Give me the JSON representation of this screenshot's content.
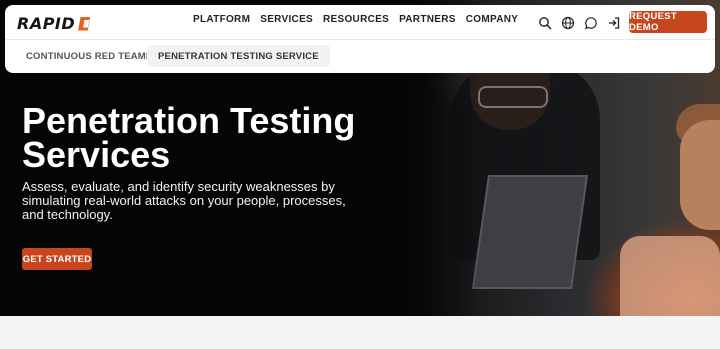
{
  "header": {
    "logo_text": "RAPID",
    "menu": [
      {
        "label": "PLATFORM"
      },
      {
        "label": "SERVICES"
      },
      {
        "label": "RESOURCES"
      },
      {
        "label": "PARTNERS"
      },
      {
        "label": "COMPANY"
      }
    ],
    "icons": [
      "search-icon",
      "globe-icon",
      "chat-icon",
      "sign-in-icon"
    ],
    "demo_label": "REQUEST DEMO"
  },
  "subnav": {
    "items": [
      {
        "label": "CONTINUOUS RED TEAMING"
      },
      {
        "label": "PENETRATION TESTING SERVICE",
        "active": true
      }
    ]
  },
  "hero": {
    "title": "Penetration Testing Services",
    "subtitle": "Assess, evaluate, and identify security weaknesses by simulating real-world attacks on your people, processes, and technology.",
    "cta_label": "GET STARTED"
  },
  "colors": {
    "accent": "#c8461d",
    "logo_mark": "#e5611f",
    "hero_bg": "#050505"
  }
}
